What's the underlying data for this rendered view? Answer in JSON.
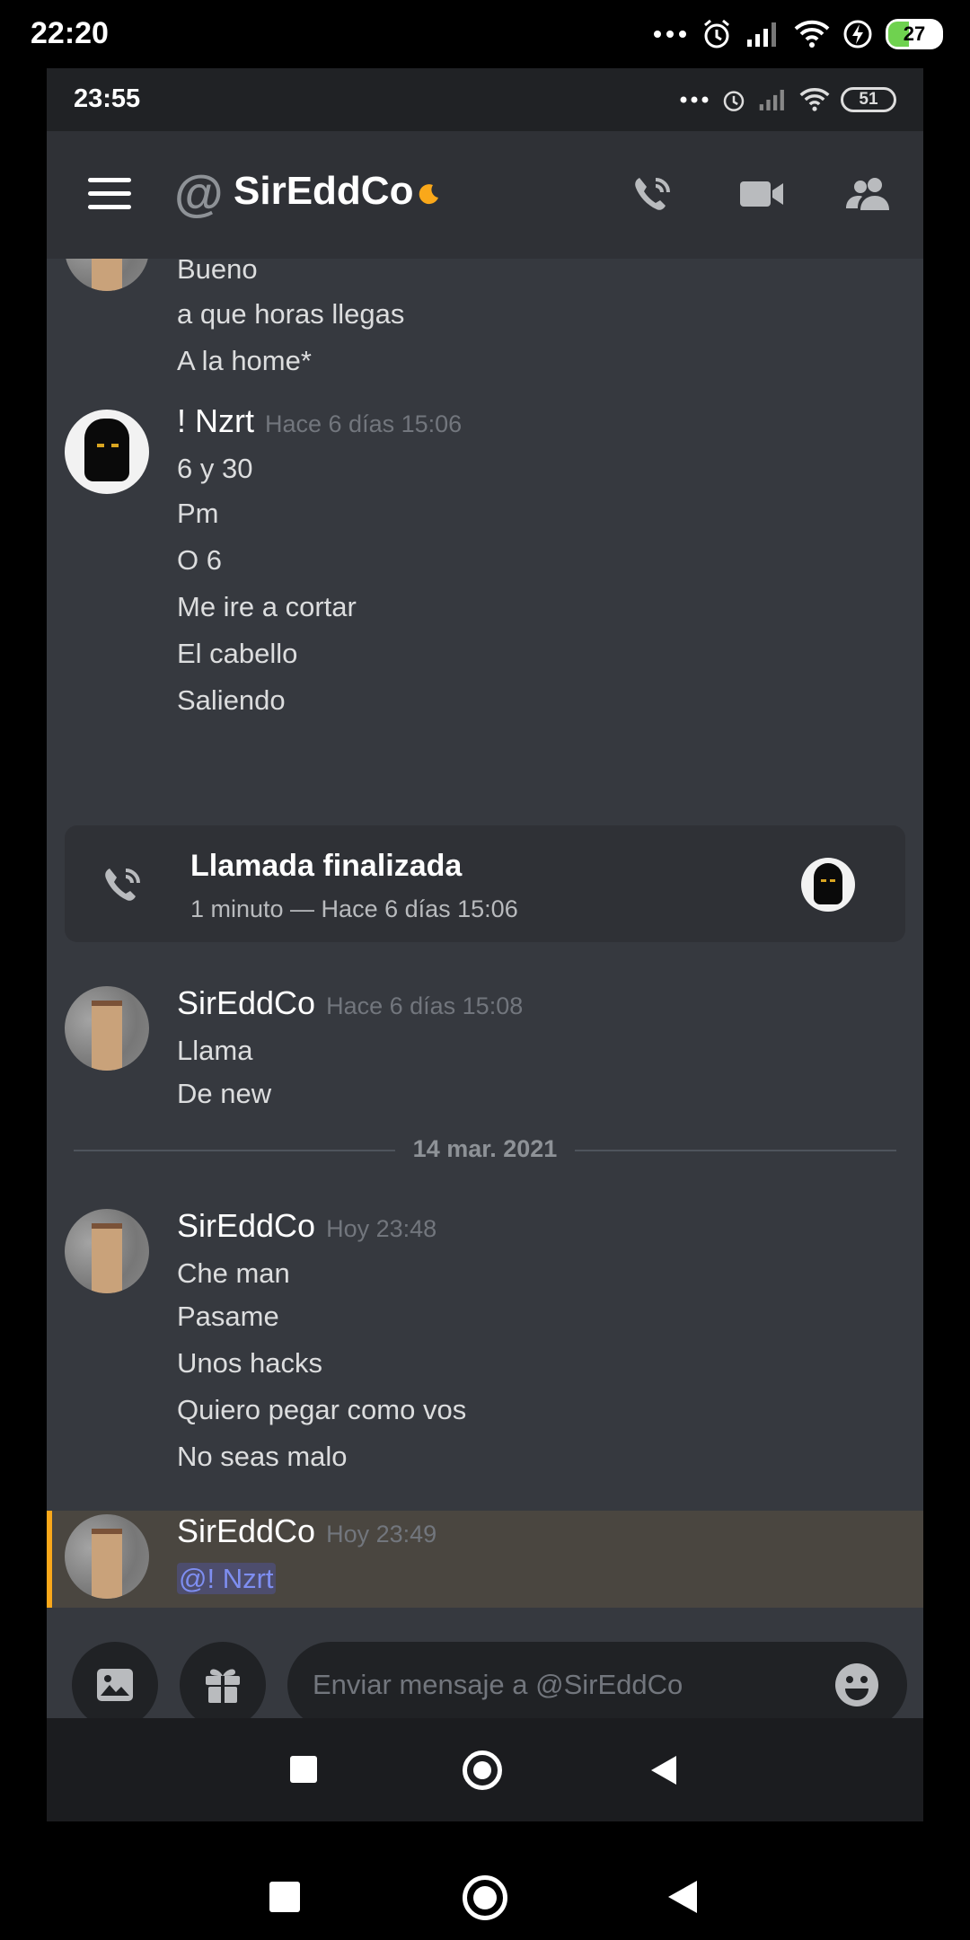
{
  "device": {
    "status_time": "22:20",
    "battery": "27",
    "icons": [
      "dots-icon",
      "alarm-icon",
      "signal-icon",
      "wifi-icon",
      "charging-icon",
      "battery-icon"
    ]
  },
  "app": {
    "status_time": "23:55",
    "battery": "51",
    "header": {
      "at_symbol": "@",
      "title": "SirEddCo",
      "icons": [
        "menu-icon",
        "call-icon",
        "video-icon",
        "members-icon"
      ],
      "accent": "#faa81a"
    },
    "messages": {
      "prev_lines": [
        "Bueno",
        "a que horas llegas",
        "A la home*"
      ],
      "nzrt": {
        "author": "! Nzrt",
        "time": "Hace 6 días 15:06",
        "lines": [
          "6 y 30",
          "Pm",
          "O 6",
          "Me ire a cortar",
          "El cabello",
          "Saliendo"
        ]
      },
      "call": {
        "title": "Llamada finalizada",
        "detail": "1 minuto — Hace 6 días 15:06"
      },
      "sir1": {
        "author": "SirEddCo",
        "time": "Hace 6 días 15:08",
        "lines": [
          "Llama",
          "De new"
        ]
      },
      "date_divider": "14 mar. 2021",
      "sir2": {
        "author": "SirEddCo",
        "time": "Hoy 23:48",
        "lines": [
          "Che man",
          "Pasame",
          "Unos hacks",
          "Quiero pegar como vos",
          "No seas malo"
        ]
      },
      "sir3": {
        "author": "SirEddCo",
        "time": "Hoy 23:49",
        "mention": "@! Nzrt"
      }
    },
    "composer": {
      "placeholder": "Enviar mensaje a @SirEddCo"
    }
  }
}
